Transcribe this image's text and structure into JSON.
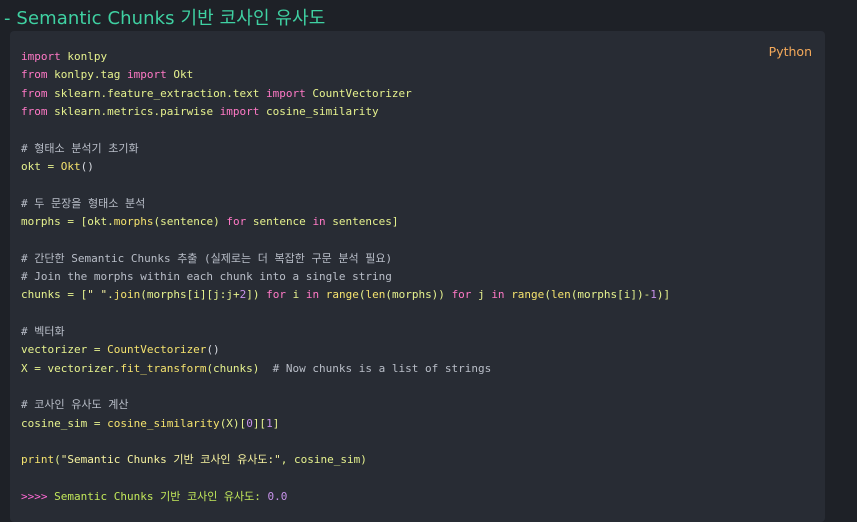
{
  "heading": "- Semantic Chunks 기반 코사인 유사도",
  "code_block": {
    "language": "Python",
    "lines": [
      [
        {
          "t": "import",
          "c": "kw"
        },
        {
          "t": " konlpy",
          "c": "tx"
        }
      ],
      [
        {
          "t": "from",
          "c": "kw"
        },
        {
          "t": " konlpy.tag ",
          "c": "tx"
        },
        {
          "t": "import",
          "c": "kw"
        },
        {
          "t": " Okt",
          "c": "tx"
        }
      ],
      [
        {
          "t": "from",
          "c": "kw"
        },
        {
          "t": " sklearn.feature_extraction.text ",
          "c": "tx"
        },
        {
          "t": "import",
          "c": "kw"
        },
        {
          "t": " CountVectorizer",
          "c": "tx"
        }
      ],
      [
        {
          "t": "from",
          "c": "kw"
        },
        {
          "t": " sklearn.metrics.pairwise ",
          "c": "tx"
        },
        {
          "t": "import",
          "c": "kw"
        },
        {
          "t": " cosine_similarity",
          "c": "tx"
        }
      ],
      [],
      [
        {
          "t": "# 형태소 분석기 초기화",
          "c": "cm"
        }
      ],
      [
        {
          "t": "okt = ",
          "c": "tx"
        },
        {
          "t": "Okt",
          "c": "fn"
        },
        {
          "t": "()",
          "c": "pu"
        }
      ],
      [],
      [
        {
          "t": "# 두 문장을 형태소 분석",
          "c": "cm"
        }
      ],
      [
        {
          "t": "morphs = [okt.",
          "c": "tx"
        },
        {
          "t": "morphs",
          "c": "fn"
        },
        {
          "t": "(sentence) ",
          "c": "tx"
        },
        {
          "t": "for",
          "c": "kw"
        },
        {
          "t": " sentence ",
          "c": "tx"
        },
        {
          "t": "in",
          "c": "kw"
        },
        {
          "t": " sentences]",
          "c": "tx"
        }
      ],
      [],
      [
        {
          "t": "# 간단한 Semantic Chunks 추출 (실제로는 더 복잡한 구문 분석 필요)",
          "c": "cm"
        }
      ],
      [
        {
          "t": "# Join the morphs within each chunk into a single string",
          "c": "cm"
        }
      ],
      [
        {
          "t": "chunks = [",
          "c": "tx"
        },
        {
          "t": "\" \"",
          "c": "str"
        },
        {
          "t": ".",
          "c": "tx"
        },
        {
          "t": "join",
          "c": "fn"
        },
        {
          "t": "(morphs[i][j:j+",
          "c": "tx"
        },
        {
          "t": "2",
          "c": "num"
        },
        {
          "t": "]) ",
          "c": "tx"
        },
        {
          "t": "for",
          "c": "kw"
        },
        {
          "t": " i ",
          "c": "tx"
        },
        {
          "t": "in",
          "c": "kw"
        },
        {
          "t": " ",
          "c": "tx"
        },
        {
          "t": "range",
          "c": "fn"
        },
        {
          "t": "(",
          "c": "tx"
        },
        {
          "t": "len",
          "c": "fn"
        },
        {
          "t": "(morphs)) ",
          "c": "tx"
        },
        {
          "t": "for",
          "c": "kw"
        },
        {
          "t": " j ",
          "c": "tx"
        },
        {
          "t": "in",
          "c": "kw"
        },
        {
          "t": " ",
          "c": "tx"
        },
        {
          "t": "range",
          "c": "fn"
        },
        {
          "t": "(",
          "c": "tx"
        },
        {
          "t": "len",
          "c": "fn"
        },
        {
          "t": "(morphs[i])-",
          "c": "tx"
        },
        {
          "t": "1",
          "c": "num"
        },
        {
          "t": ")]",
          "c": "tx"
        }
      ],
      [],
      [
        {
          "t": "# 벡터화",
          "c": "cm"
        }
      ],
      [
        {
          "t": "vectorizer = ",
          "c": "tx"
        },
        {
          "t": "CountVectorizer",
          "c": "fn"
        },
        {
          "t": "()",
          "c": "pu"
        }
      ],
      [
        {
          "t": "X = vectorizer.",
          "c": "tx"
        },
        {
          "t": "fit_transform",
          "c": "fn"
        },
        {
          "t": "(chunks)  ",
          "c": "tx"
        },
        {
          "t": "# Now chunks is a list of strings",
          "c": "cm"
        }
      ],
      [],
      [
        {
          "t": "# 코사인 유사도 계산",
          "c": "cm"
        }
      ],
      [
        {
          "t": "cosine_sim = ",
          "c": "tx"
        },
        {
          "t": "cosine_similarity",
          "c": "fn"
        },
        {
          "t": "(X)[",
          "c": "tx"
        },
        {
          "t": "0",
          "c": "num"
        },
        {
          "t": "][",
          "c": "tx"
        },
        {
          "t": "1",
          "c": "num"
        },
        {
          "t": "]",
          "c": "tx"
        }
      ],
      [],
      [
        {
          "t": "print",
          "c": "fn"
        },
        {
          "t": "(",
          "c": "tx"
        },
        {
          "t": "\"Semantic Chunks 기반 코사인 유사도:\"",
          "c": "str"
        },
        {
          "t": ", cosine_sim)",
          "c": "tx"
        }
      ],
      [],
      [
        {
          "t": ">>>> ",
          "c": "pr"
        },
        {
          "t": "Semantic Chunks 기반 코사인 유사도: ",
          "c": "out"
        },
        {
          "t": "0.0",
          "c": "num"
        }
      ]
    ]
  }
}
